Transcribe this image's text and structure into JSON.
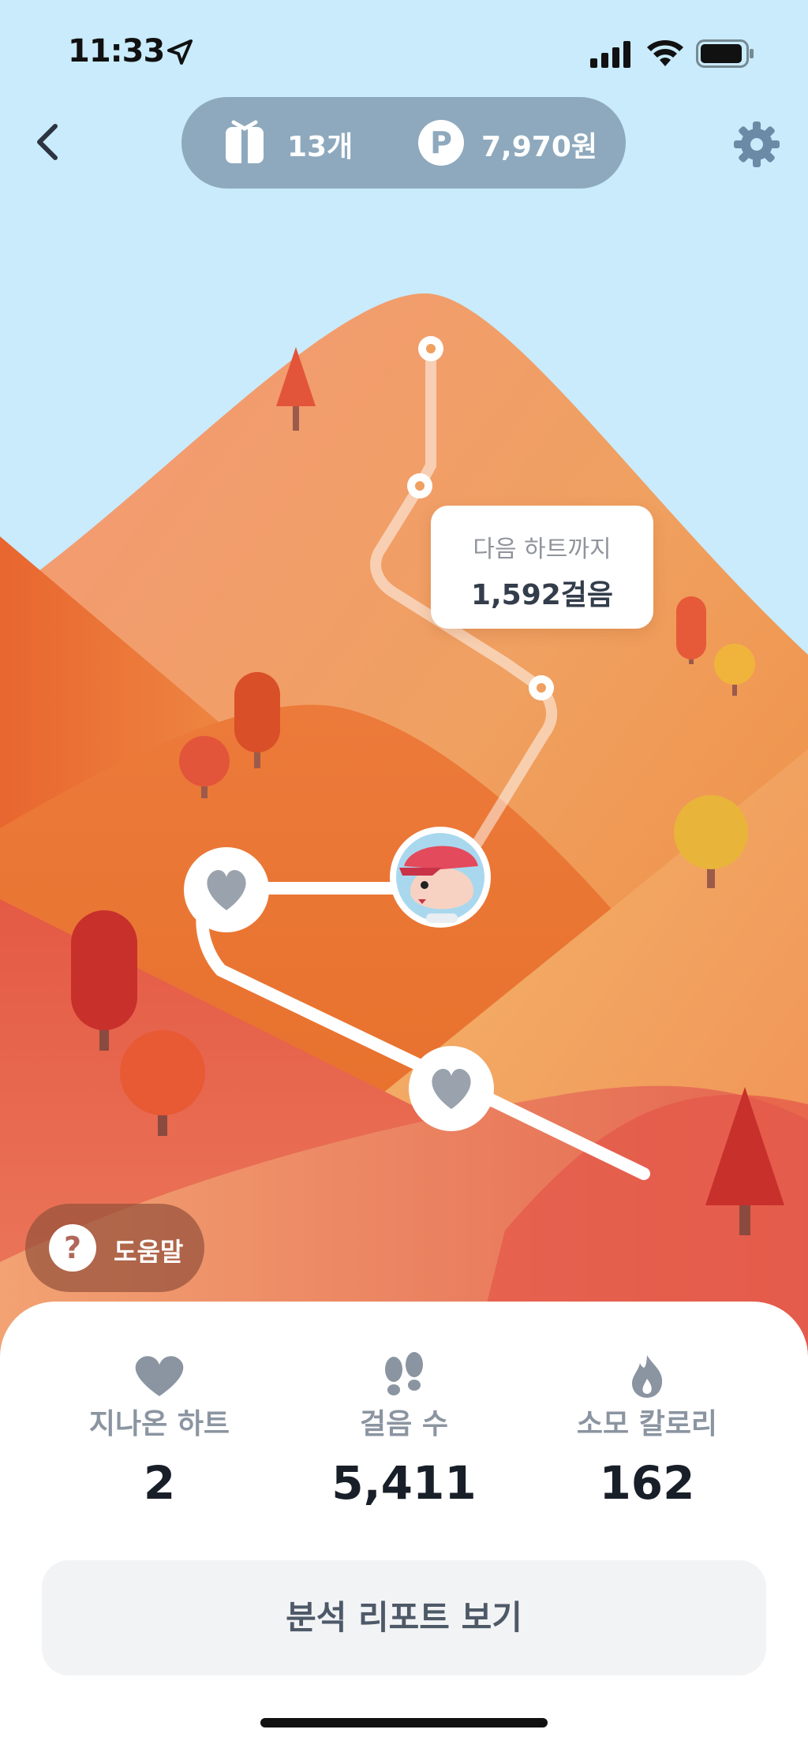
{
  "status_bar": {
    "time": "11:33"
  },
  "header": {
    "gift_count": "13개",
    "points": "7,970원",
    "points_symbol": "P"
  },
  "map": {
    "bubble_label": "다음 하트까지",
    "bubble_value": "1,592걸음"
  },
  "help": {
    "icon": "?",
    "label": "도움말"
  },
  "stats": [
    {
      "icon": "heart-icon",
      "label": "지나온 하트",
      "value": "2"
    },
    {
      "icon": "footprints-icon",
      "label": "걸음 수",
      "value": "5,411"
    },
    {
      "icon": "flame-icon",
      "label": "소모 칼로리",
      "value": "162"
    }
  ],
  "report_button": "분석 리포트 보기",
  "colors": {
    "sky": "#c9ebfb",
    "pill": "#8ea9bd",
    "label_gray": "#8b95a1",
    "value_dark": "#191f28"
  }
}
